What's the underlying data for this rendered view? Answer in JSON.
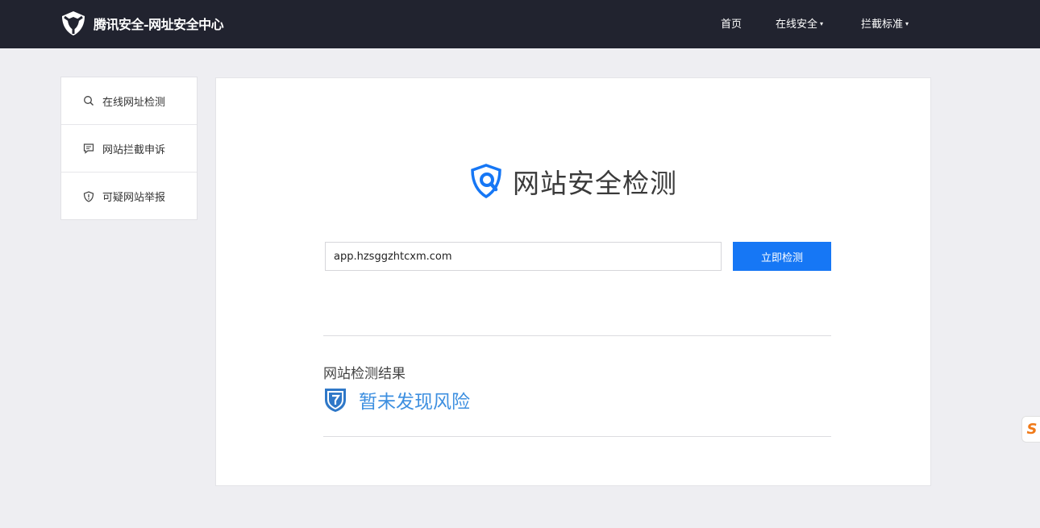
{
  "header": {
    "brand_title": "腾讯安全-网址安全中心",
    "nav": [
      {
        "label": "首页",
        "has_dropdown": false
      },
      {
        "label": "在线安全",
        "has_dropdown": true
      },
      {
        "label": "拦截标准",
        "has_dropdown": true
      }
    ],
    "caret": "▾"
  },
  "sidebar": {
    "items": [
      {
        "label": "在线网址检测",
        "icon": "search-icon"
      },
      {
        "label": "网站拦截申诉",
        "icon": "chat-bubble-icon"
      },
      {
        "label": "可疑网站举报",
        "icon": "shield-alert-icon"
      }
    ]
  },
  "main": {
    "hero_title": "网站安全检测",
    "url_input": {
      "value": "app.hzsggzhtcxm.com",
      "placeholder": ""
    },
    "check_button_label": "立即检测",
    "result": {
      "title": "网站检测结果",
      "status_text": "暂未发现风险",
      "status_color": "#3d8fe0"
    }
  },
  "floating_widget": {
    "glyph": "S",
    "icon": "sogou-input-icon"
  },
  "colors": {
    "topbar_bg": "#21232f",
    "accent": "#1677f5",
    "page_bg": "#eeeef2"
  }
}
